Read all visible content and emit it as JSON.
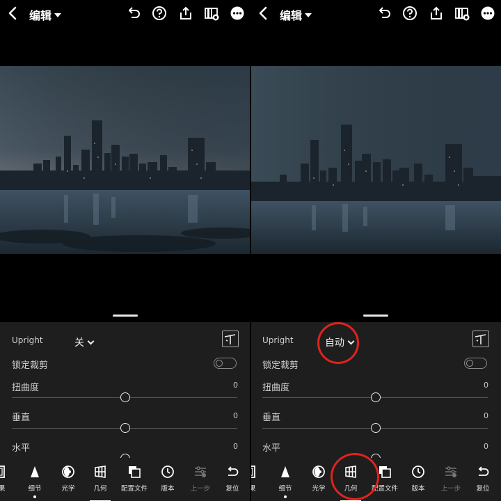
{
  "left": {
    "header": {
      "title": "编辑"
    },
    "upright": {
      "label": "Upright",
      "value": "关"
    },
    "lock_crop": {
      "label": "锁定裁剪"
    },
    "distortion": {
      "label": "扭曲度",
      "value": "0"
    },
    "vertical": {
      "label": "垂直",
      "value": "0"
    },
    "horizontal": {
      "label": "水平",
      "value": "0"
    },
    "toolbar": [
      {
        "label": "效果"
      },
      {
        "label": "细节"
      },
      {
        "label": "光学"
      },
      {
        "label": "几何"
      },
      {
        "label": "配置文件"
      },
      {
        "label": "版本"
      },
      {
        "label": "上一步"
      },
      {
        "label": "复位"
      }
    ]
  },
  "right": {
    "header": {
      "title": "编辑"
    },
    "upright": {
      "label": "Upright",
      "value": "自动"
    },
    "lock_crop": {
      "label": "锁定裁剪"
    },
    "distortion": {
      "label": "扭曲度",
      "value": "0"
    },
    "vertical": {
      "label": "垂直",
      "value": "0"
    },
    "horizontal": {
      "label": "水平",
      "value": "0"
    },
    "toolbar": [
      {
        "label": "效果"
      },
      {
        "label": "细节"
      },
      {
        "label": "光学"
      },
      {
        "label": "几何"
      },
      {
        "label": "配置文件"
      },
      {
        "label": "版本"
      },
      {
        "label": "上一步"
      },
      {
        "label": "复位"
      }
    ]
  },
  "colors": {
    "panel_bg": "#1e1e1e",
    "annotation_red": "#e0231c"
  }
}
